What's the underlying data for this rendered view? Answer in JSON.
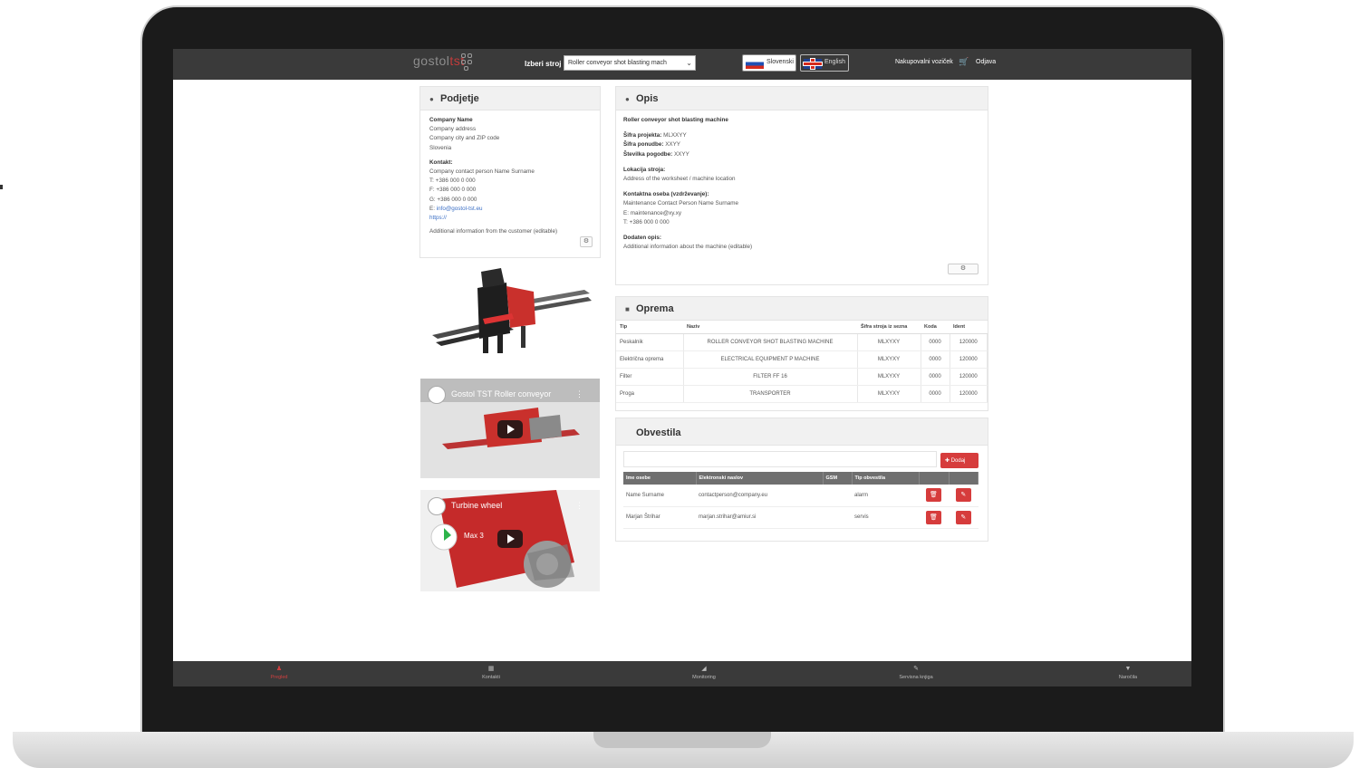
{
  "topbar": {
    "logo_main": "gostol",
    "logo_accent": "tst",
    "machine_label": "Izberi stroj",
    "machine_selected": "Roller conveyor shot blasting mach",
    "languages": [
      "Slovenski",
      "English"
    ],
    "cart_label": "Nakupovalni voziček",
    "logout_label": "Odjava"
  },
  "company": {
    "title": "Podjetje",
    "name": "Company Name",
    "address": "Company address",
    "city": "Company city and ZIP code",
    "country": "Slovenia",
    "contact_title": "Kontakt:",
    "contact_person": "Company contact person Name Surname",
    "phone": "T: +386 000 0 000",
    "fax": "F: +386 000 0 000",
    "mobile": "G: +386 000 0 000",
    "email_prefix": "E:",
    "email": "info@gostol-tst.eu",
    "web": "https://",
    "additional": "Additional information from the customer (editable)",
    "gear": "⚙"
  },
  "videos": [
    {
      "title": "Gostol TST Roller conveyor"
    },
    {
      "title": "Turbine wheel",
      "badge": "Max 3"
    }
  ],
  "opis": {
    "title": "Opis",
    "machine": "Roller conveyor shot blasting machine",
    "project_label": "Šifra projekta:",
    "project_value": "MLXXYY",
    "offer_label": "Šifra ponudbe:",
    "offer_value": "XXYY",
    "contract_label": "Številka pogodbe:",
    "contract_value": "XXYY",
    "location_label": "Lokacija stroja:",
    "location_value": "Address of the worksheet / machine location",
    "maintenance_label": "Kontaktna oseba (vzdrževanje):",
    "maintenance_person": "Maintenance Contact Person Name Surname",
    "maintenance_email": "E: maintenance@xy.xy",
    "maintenance_phone": "T: +386 000 0 000",
    "extra_label": "Dodaten opis:",
    "extra_value": "Additional information about the machine (editable)"
  },
  "oprema": {
    "title": "Oprema",
    "headers": [
      "Tip",
      "Naziv",
      "Šifra stroja iz sezna",
      "Koda",
      "Ident"
    ],
    "rows": [
      [
        "Peskalnik",
        "ROLLER CONVEYOR SHOT BLASTING MACHINE",
        "MLXYXY",
        "0000",
        "120000"
      ],
      [
        "Električna oprema",
        "ELECTRICAL EQUIPMENT P MACHINE",
        "MLXYXY",
        "0000",
        "120000"
      ],
      [
        "Filter",
        "FILTER FF 16",
        "MLXYXY",
        "0000",
        "120000"
      ],
      [
        "Proga",
        "TRANSPORTER",
        "MLXYXY",
        "0000",
        "120000"
      ]
    ]
  },
  "obvestila": {
    "title": "Obvestila",
    "add_label": "Dodaj",
    "headers": [
      "Ime osebe",
      "Elektronski naslov",
      "GSM",
      "Tip obvestila",
      "",
      ""
    ],
    "rows": [
      [
        "Name Surname",
        "contactperson@company.eu",
        "",
        "alarm"
      ],
      [
        "Marjan Štrihar",
        "marjan.strihar@amiur.si",
        "",
        "servis"
      ]
    ]
  },
  "bottomnav": {
    "items": [
      "Pregled",
      "Kontakti",
      "Monitoring",
      "Servisna knjiga",
      "Naročila"
    ]
  },
  "colors": {
    "accent": "#d63c3c",
    "bar": "#3a3a3a"
  }
}
